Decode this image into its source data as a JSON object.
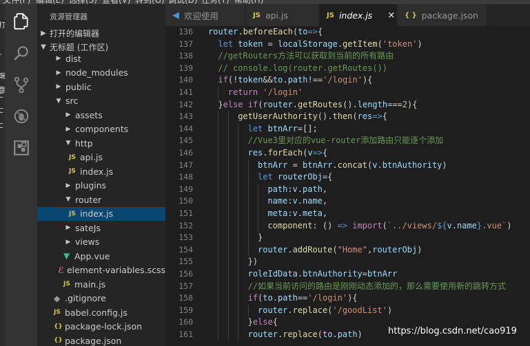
{
  "menubar": {
    "items": [
      "文件(F)",
      "编辑(E)",
      "选择(S)",
      "查看(V)",
      "转到(G)",
      "调试(D)",
      "任务(T)",
      "帮助(H)"
    ]
  },
  "left_peek": {
    "chars": [
      "打",
      "r",
      "端",
      "盘",
      "C",
      "C",
      "C"
    ]
  },
  "activity_bar": {
    "items": [
      {
        "name": "explorer",
        "icon": "files-icon"
      },
      {
        "name": "search",
        "icon": "search-icon"
      },
      {
        "name": "source-control",
        "icon": "source-control-icon"
      },
      {
        "name": "debug",
        "icon": "debug-icon"
      },
      {
        "name": "extensions",
        "icon": "extensions-icon"
      }
    ]
  },
  "sidebar": {
    "title": "资源管理器",
    "open_editors": "打开的编辑器",
    "workspace": "无标题 (工作区)",
    "tree": [
      {
        "label": "dist",
        "type": "folder",
        "depth": 1,
        "expanded": false
      },
      {
        "label": "node_modules",
        "type": "folder",
        "depth": 1,
        "expanded": false
      },
      {
        "label": "public",
        "type": "folder",
        "depth": 1,
        "expanded": false
      },
      {
        "label": "src",
        "type": "folder",
        "depth": 1,
        "expanded": true
      },
      {
        "label": "assets",
        "type": "folder",
        "depth": 2,
        "expanded": false
      },
      {
        "label": "components",
        "type": "folder",
        "depth": 2,
        "expanded": false
      },
      {
        "label": "http",
        "type": "folder",
        "depth": 2,
        "expanded": true
      },
      {
        "label": "api.js",
        "type": "js",
        "depth": 3
      },
      {
        "label": "index.js",
        "type": "js",
        "depth": 3
      },
      {
        "label": "plugins",
        "type": "folder",
        "depth": 2,
        "expanded": false
      },
      {
        "label": "router",
        "type": "folder",
        "depth": 2,
        "expanded": true
      },
      {
        "label": "index.js",
        "type": "js",
        "depth": 3,
        "selected": true
      },
      {
        "label": "sateJs",
        "type": "folder",
        "depth": 2,
        "expanded": false
      },
      {
        "label": "views",
        "type": "folder",
        "depth": 2,
        "expanded": false
      },
      {
        "label": "App.vue",
        "type": "vue",
        "depth": 2
      },
      {
        "label": "element-variables.scss",
        "type": "scss",
        "depth": 2
      },
      {
        "label": "main.js",
        "type": "js",
        "depth": 2
      },
      {
        "label": ".gitignore",
        "type": "git",
        "depth": 1
      },
      {
        "label": "babel.config.js",
        "type": "js",
        "depth": 1
      },
      {
        "label": "package-lock.json",
        "type": "json",
        "depth": 1
      },
      {
        "label": "package.json",
        "type": "json",
        "depth": 1
      }
    ]
  },
  "tabs": [
    {
      "label": "欢迎使用",
      "icon": "vscode-icon",
      "active": false
    },
    {
      "label": "api.js",
      "icon": "js-icon",
      "active": false
    },
    {
      "label": "index.js",
      "icon": "js-icon",
      "active": true,
      "close": "×"
    },
    {
      "label": "package.json",
      "icon": "json-icon",
      "active": false
    }
  ],
  "editor": {
    "lines": [
      {
        "n": "136",
        "indent": 0,
        "tokens": [
          [
            "id",
            "router"
          ],
          [
            "pl",
            "."
          ],
          [
            "fn",
            "beforeEach"
          ],
          [
            "pl",
            "("
          ],
          [
            "id",
            "to"
          ],
          [
            "kw",
            "=>"
          ],
          [
            "pl",
            "{"
          ]
        ]
      },
      {
        "n": "137",
        "indent": 1,
        "tokens": [
          [
            "kw",
            "let "
          ],
          [
            "id",
            "token"
          ],
          [
            "pl",
            " = "
          ],
          [
            "id",
            "localStorage"
          ],
          [
            "pl",
            "."
          ],
          [
            "fn",
            "getItem"
          ],
          [
            "pl",
            "("
          ],
          [
            "str",
            "'token'"
          ],
          [
            "pl",
            ")"
          ]
        ]
      },
      {
        "n": "138",
        "indent": 1,
        "tokens": [
          [
            "cm",
            "//getRouters方法可以获取到当前的所有路由"
          ]
        ]
      },
      {
        "n": "139",
        "indent": 1,
        "tokens": [
          [
            "cm",
            "// console.log(router.getRoutes())"
          ]
        ]
      },
      {
        "n": "140",
        "indent": 1,
        "tokens": [
          [
            "kw2",
            "if"
          ],
          [
            "pl",
            "(!"
          ],
          [
            "id",
            "token"
          ],
          [
            "pl",
            "&&"
          ],
          [
            "id",
            "to"
          ],
          [
            "pl",
            "."
          ],
          [
            "id",
            "path"
          ],
          [
            "pl",
            "!=="
          ],
          [
            "str",
            "'/login'"
          ],
          [
            "pl",
            "){"
          ]
        ]
      },
      {
        "n": "141",
        "indent": 2,
        "tokens": [
          [
            "kw2",
            "return "
          ],
          [
            "str",
            "'/login'"
          ]
        ]
      },
      {
        "n": "142",
        "indent": 1,
        "tokens": [
          [
            "pl",
            "}"
          ],
          [
            "kw2",
            "else if"
          ],
          [
            "pl",
            "("
          ],
          [
            "id",
            "router"
          ],
          [
            "pl",
            "."
          ],
          [
            "fn",
            "getRoutes"
          ],
          [
            "pl",
            "()."
          ],
          [
            "id",
            "length"
          ],
          [
            "pl",
            "==="
          ],
          [
            "num",
            "2"
          ],
          [
            "pl",
            "){"
          ]
        ]
      },
      {
        "n": "143",
        "indent": 3,
        "tokens": [
          [
            "fn",
            "getUserAuthority"
          ],
          [
            "pl",
            "()."
          ],
          [
            "fn",
            "then"
          ],
          [
            "pl",
            "("
          ],
          [
            "id",
            "res"
          ],
          [
            "kw",
            "=>"
          ],
          [
            "pl",
            "{"
          ]
        ]
      },
      {
        "n": "144",
        "indent": 4,
        "tokens": [
          [
            "kw",
            "let "
          ],
          [
            "id",
            "btnArr"
          ],
          [
            "pl",
            "=[];"
          ]
        ]
      },
      {
        "n": "145",
        "indent": 4,
        "tokens": [
          [
            "cm",
            "//Vue3里对应的vue-router添加路由只能逐个添加"
          ]
        ]
      },
      {
        "n": "146",
        "indent": 4,
        "tokens": [
          [
            "id",
            "res"
          ],
          [
            "pl",
            "."
          ],
          [
            "fn",
            "forEach"
          ],
          [
            "pl",
            "("
          ],
          [
            "id",
            "v"
          ],
          [
            "kw",
            "=>"
          ],
          [
            "pl",
            "{"
          ]
        ]
      },
      {
        "n": "147",
        "indent": 5,
        "tokens": [
          [
            "id",
            "btnArr"
          ],
          [
            "pl",
            " = "
          ],
          [
            "id",
            "btnArr"
          ],
          [
            "pl",
            "."
          ],
          [
            "fn",
            "concat"
          ],
          [
            "pl",
            "("
          ],
          [
            "id",
            "v"
          ],
          [
            "pl",
            "."
          ],
          [
            "id",
            "btnAuthority"
          ],
          [
            "pl",
            ")"
          ]
        ]
      },
      {
        "n": "148",
        "indent": 5,
        "tokens": [
          [
            "kw",
            "let "
          ],
          [
            "id",
            "routerObj"
          ],
          [
            "pl",
            "={"
          ]
        ]
      },
      {
        "n": "149",
        "indent": 6,
        "tokens": [
          [
            "id",
            "path"
          ],
          [
            "pl",
            ":"
          ],
          [
            "id",
            "v"
          ],
          [
            "pl",
            "."
          ],
          [
            "id",
            "path"
          ],
          [
            "pl",
            ","
          ]
        ]
      },
      {
        "n": "150",
        "indent": 6,
        "tokens": [
          [
            "id",
            "name"
          ],
          [
            "pl",
            ":"
          ],
          [
            "id",
            "v"
          ],
          [
            "pl",
            "."
          ],
          [
            "id",
            "name"
          ],
          [
            "pl",
            ","
          ]
        ]
      },
      {
        "n": "151",
        "indent": 6,
        "tokens": [
          [
            "id",
            "meta"
          ],
          [
            "pl",
            ":"
          ],
          [
            "id",
            "v"
          ],
          [
            "pl",
            "."
          ],
          [
            "id",
            "meta"
          ],
          [
            "pl",
            ","
          ]
        ]
      },
      {
        "n": "152",
        "indent": 6,
        "tokens": [
          [
            "fn",
            "component"
          ],
          [
            "pl",
            ": () "
          ],
          [
            "kw",
            "=>"
          ],
          [
            "pl",
            " "
          ],
          [
            "kw2",
            "import"
          ],
          [
            "pl",
            "("
          ],
          [
            "str",
            "`../views/"
          ],
          [
            "kw",
            "${"
          ],
          [
            "id",
            "v"
          ],
          [
            "pl",
            "."
          ],
          [
            "id",
            "name"
          ],
          [
            "kw",
            "}"
          ],
          [
            "str",
            ".vue`"
          ],
          [
            "pl",
            ")"
          ]
        ]
      },
      {
        "n": "153",
        "indent": 5,
        "tokens": [
          [
            "pl",
            "}"
          ]
        ]
      },
      {
        "n": "154",
        "indent": 5,
        "tokens": [
          [
            "id",
            "router"
          ],
          [
            "pl",
            "."
          ],
          [
            "fn",
            "addRoute"
          ],
          [
            "pl",
            "("
          ],
          [
            "str",
            "\"Home\""
          ],
          [
            "pl",
            ","
          ],
          [
            "id",
            "routerObj"
          ],
          [
            "pl",
            ")"
          ]
        ]
      },
      {
        "n": "155",
        "indent": 4,
        "tokens": [
          [
            "pl",
            "})"
          ]
        ]
      },
      {
        "n": "156",
        "indent": 4,
        "tokens": [
          [
            "id",
            "roleIdData"
          ],
          [
            "pl",
            "."
          ],
          [
            "id",
            "btnAuthority"
          ],
          [
            "pl",
            "="
          ],
          [
            "id",
            "btnArr"
          ]
        ]
      },
      {
        "n": "157",
        "indent": 4,
        "tokens": [
          [
            "cm",
            "//如果当前访问的路由是刚刚动态添加的，那么需要使用新的跳转方式"
          ]
        ]
      },
      {
        "n": "158",
        "indent": 4,
        "tokens": [
          [
            "kw2",
            "if"
          ],
          [
            "pl",
            "("
          ],
          [
            "id",
            "to"
          ],
          [
            "pl",
            "."
          ],
          [
            "id",
            "path"
          ],
          [
            "pl",
            "=="
          ],
          [
            "str",
            "'/login'"
          ],
          [
            "pl",
            "){"
          ]
        ]
      },
      {
        "n": "159",
        "indent": 5,
        "tokens": [
          [
            "id",
            "router"
          ],
          [
            "pl",
            "."
          ],
          [
            "fn",
            "replace"
          ],
          [
            "pl",
            "("
          ],
          [
            "str",
            "'/goodList'"
          ],
          [
            "pl",
            ")"
          ]
        ]
      },
      {
        "n": "160",
        "indent": 4,
        "tokens": [
          [
            "pl",
            "}"
          ],
          [
            "kw2",
            "else"
          ],
          [
            "pl",
            "{"
          ]
        ]
      },
      {
        "n": "161",
        "indent": 4,
        "tokens": [
          [
            "id",
            "router"
          ],
          [
            "pl",
            "."
          ],
          [
            "fn",
            "replace"
          ],
          [
            "pl",
            "("
          ],
          [
            "id",
            "to"
          ],
          [
            "pl",
            "."
          ],
          [
            "id",
            "path"
          ],
          [
            "pl",
            ")"
          ]
        ]
      }
    ]
  },
  "watermark": "https://blog.csdn.net/cao919",
  "colors": {
    "editor_bg": "#1e1e1e",
    "sidebar_bg": "#252526",
    "activity_bg": "#333333",
    "selection": "#094771",
    "keyword": "#569cd6",
    "control": "#c586c0",
    "identifier": "#9cdcfe",
    "function": "#dcdcaa",
    "string": "#ce9178",
    "comment": "#6a9955",
    "number": "#b5cea8"
  }
}
